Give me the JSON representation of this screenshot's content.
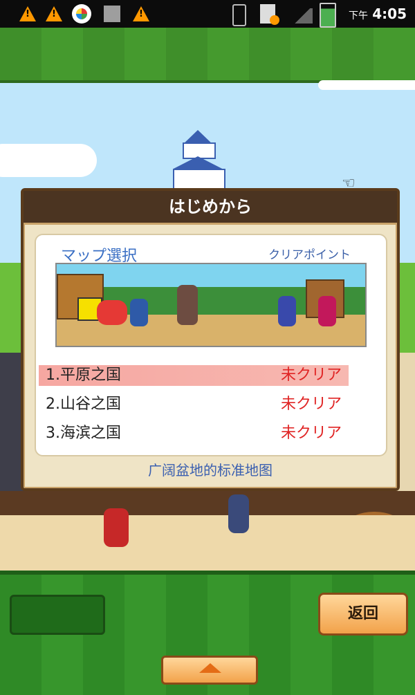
{
  "status_bar": {
    "ampm": "下午",
    "time": "4:05",
    "icons": [
      "warning-icon",
      "warning-icon",
      "photo-app-icon",
      "usb-icon",
      "warning-icon",
      "vibrate-icon",
      "sd-card-alert-icon",
      "no-signal-icon",
      "battery-charging-icon"
    ]
  },
  "dialog": {
    "title": "はじめから",
    "map_select_label": "マップ選択",
    "clear_points_label": "クリアポイント",
    "maps": [
      {
        "name": "1.平原之国",
        "status": "未クリア",
        "selected": true
      },
      {
        "name": "2.山谷之国",
        "status": "未クリア",
        "selected": false
      },
      {
        "name": "3.海滨之国",
        "status": "未クリア",
        "selected": false
      }
    ],
    "description": "广阔盆地的标准地图"
  },
  "controls": {
    "back_label": "返回",
    "up_icon": "up-arrow-icon"
  },
  "colors": {
    "accent_green": "#2f8a26",
    "dialog_brown": "#4b3421",
    "selected_row": "#f6a7a1",
    "status_red": "#e02424",
    "button_orange": "#f2a24a"
  }
}
